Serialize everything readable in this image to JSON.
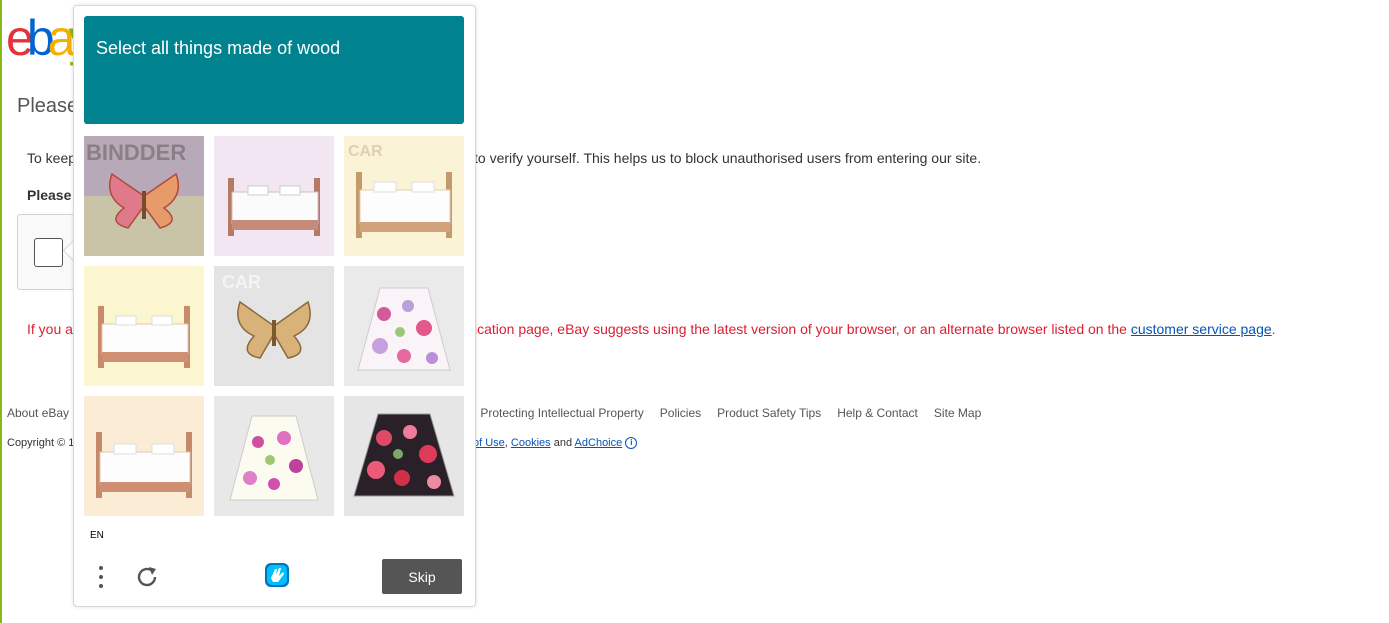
{
  "logo": {
    "e1": "e",
    "b": "b",
    "a": "a",
    "y": "y",
    "overlap_e": "e"
  },
  "page": {
    "title": "Please",
    "intro_start": "To keep",
    "intro_end": "to verify yourself. This helps us to block unauthorised users from entering our site.",
    "verify_heading": "Please",
    "warning_start": "If you a",
    "warning_mid": "ication page, eBay suggests using the latest version of your browser, or an alternate browser listed on the ",
    "warning_link": "customer service page",
    "warning_end": "."
  },
  "footer": {
    "about": "About eBay",
    "links": [
      "o: Protecting Intellectual Property",
      "Policies",
      "Product Safety Tips",
      "Help & Contact",
      "Site Map"
    ],
    "copyright_start": "Copyright © 1",
    "terms": "of Use",
    "comma": ",",
    "cookies": "Cookies",
    "and": "and",
    "adchoice": "AdChoice",
    "info_glyph": "i"
  },
  "challenge": {
    "prompt": "Select all things made of wood",
    "language": "EN",
    "skip_label": "Skip",
    "accent_color": "#00838f",
    "tiles": [
      {
        "subject": "butterfly",
        "overlay_text": "BINDDER"
      },
      {
        "subject": "bed",
        "overlay_text": ""
      },
      {
        "subject": "bed",
        "overlay_text": "CAR"
      },
      {
        "subject": "bed",
        "overlay_text": ""
      },
      {
        "subject": "butterfly",
        "overlay_text": "CAR"
      },
      {
        "subject": "skirt",
        "overlay_text": ""
      },
      {
        "subject": "bed",
        "overlay_text": ""
      },
      {
        "subject": "skirt",
        "overlay_text": ""
      },
      {
        "subject": "skirt-dark",
        "overlay_text": ""
      }
    ]
  }
}
